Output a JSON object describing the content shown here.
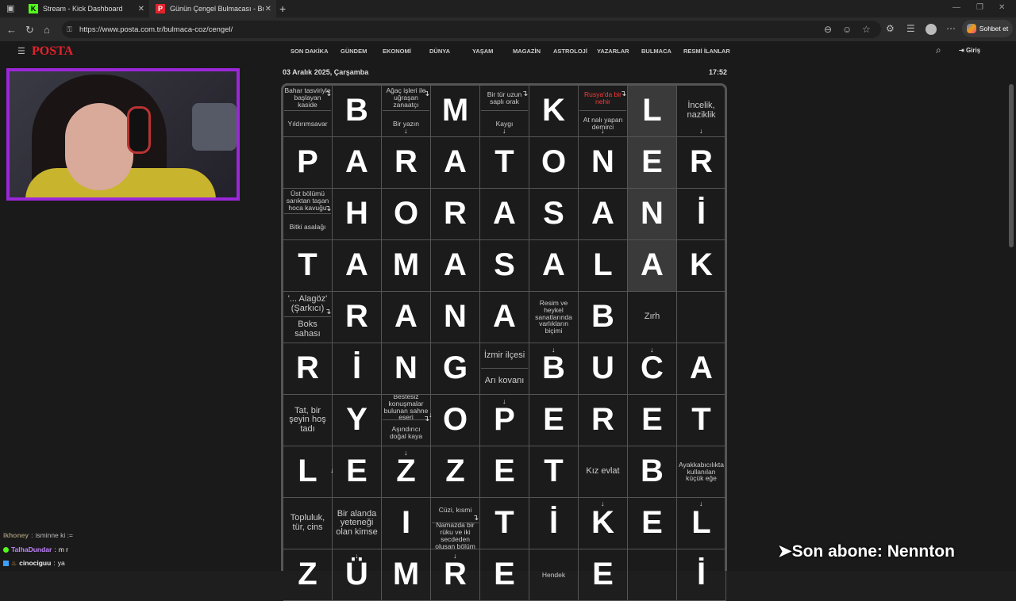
{
  "tabs": [
    {
      "title": "Stream - Kick Dashboard",
      "favicon": "K"
    },
    {
      "title": "Günün Çengel Bulmacası - Bugün",
      "favicon": "P"
    }
  ],
  "address": "https://www.posta.com.tr/bulmaca-coz/cengel/",
  "chat_button": "Sohbet et",
  "site": {
    "logo": "POSTA",
    "menu": [
      "SON DAKİKA",
      "GÜNDEM",
      "EKONOMİ",
      "DÜNYA",
      "YAŞAM",
      "MAGAZİN",
      "ASTROLOJİ",
      "YAZARLAR",
      "BULMACA",
      "RESMİ İLANLAR"
    ],
    "login": "Giriş",
    "date": "03 Aralık 2025, Çarşamba",
    "time": "17:52"
  },
  "grid": [
    [
      {
        "t": "split",
        "top": "Bahar tasviriyle başlayan kaside",
        "bot": "Yıldırımsavar"
      },
      {
        "t": "L",
        "v": "B"
      },
      {
        "t": "split",
        "top": "Ağaç işleri ile uğraşan zanaatçı",
        "bot": "Bir yazın"
      },
      {
        "t": "L",
        "v": "M"
      },
      {
        "t": "split",
        "top": "Bir tür uzun saplı orak",
        "bot": "Kaygı"
      },
      {
        "t": "L",
        "v": "K"
      },
      {
        "t": "split",
        "top": "Rusya'da bir nehir",
        "bot": "At nalı yapan demirci",
        "red": true
      },
      {
        "t": "L",
        "v": "L",
        "hl": true
      },
      {
        "t": "clue",
        "v": "İncelik, naziklik",
        "big": true
      }
    ],
    [
      {
        "t": "L",
        "v": "P"
      },
      {
        "t": "L",
        "v": "A"
      },
      {
        "t": "L",
        "v": "R"
      },
      {
        "t": "L",
        "v": "A"
      },
      {
        "t": "L",
        "v": "T"
      },
      {
        "t": "L",
        "v": "O"
      },
      {
        "t": "L",
        "v": "N"
      },
      {
        "t": "L",
        "v": "E",
        "hl": true
      },
      {
        "t": "L",
        "v": "R"
      }
    ],
    [
      {
        "t": "split",
        "top": "Üst bölümü sarıktan taşan hoca kavuğu",
        "bot": "Bitki asalağı"
      },
      {
        "t": "L",
        "v": "H"
      },
      {
        "t": "L",
        "v": "O"
      },
      {
        "t": "L",
        "v": "R"
      },
      {
        "t": "L",
        "v": "A"
      },
      {
        "t": "L",
        "v": "S"
      },
      {
        "t": "L",
        "v": "A"
      },
      {
        "t": "L",
        "v": "N",
        "hl": true
      },
      {
        "t": "L",
        "v": "İ"
      }
    ],
    [
      {
        "t": "L",
        "v": "T"
      },
      {
        "t": "L",
        "v": "A"
      },
      {
        "t": "L",
        "v": "M"
      },
      {
        "t": "L",
        "v": "A"
      },
      {
        "t": "L",
        "v": "S"
      },
      {
        "t": "L",
        "v": "A"
      },
      {
        "t": "L",
        "v": "L"
      },
      {
        "t": "L",
        "v": "A",
        "hl": true
      },
      {
        "t": "L",
        "v": "K"
      }
    ],
    [
      {
        "t": "split",
        "top": "'... Alagöz' (Şarkıcı)",
        "bot": "Boks sahası",
        "big": true
      },
      {
        "t": "L",
        "v": "R"
      },
      {
        "t": "L",
        "v": "A"
      },
      {
        "t": "L",
        "v": "N"
      },
      {
        "t": "L",
        "v": "A"
      },
      {
        "t": "clue",
        "v": "Resim ve heykel sanatlarında varlıkların biçimi"
      },
      {
        "t": "L",
        "v": "B"
      },
      {
        "t": "clue",
        "v": "Zırh",
        "big": true
      },
      {
        "t": "empty"
      }
    ],
    [
      {
        "t": "L",
        "v": "R"
      },
      {
        "t": "L",
        "v": "İ"
      },
      {
        "t": "L",
        "v": "N"
      },
      {
        "t": "L",
        "v": "G"
      },
      {
        "t": "split",
        "top": "İzmir ilçesi",
        "bot": "Arı kovanı",
        "big": true
      },
      {
        "t": "L",
        "v": "B"
      },
      {
        "t": "L",
        "v": "U"
      },
      {
        "t": "L",
        "v": "C"
      },
      {
        "t": "L",
        "v": "A"
      }
    ],
    [
      {
        "t": "clue",
        "v": "Tat, bir şeyin hoş tadı",
        "big": true
      },
      {
        "t": "L",
        "v": "Y"
      },
      {
        "t": "split",
        "top": "Bestesiz konuşmalar bulunan sahne eseri",
        "bot": "Aşındırıcı doğal kaya"
      },
      {
        "t": "L",
        "v": "O"
      },
      {
        "t": "L",
        "v": "P"
      },
      {
        "t": "L",
        "v": "E"
      },
      {
        "t": "L",
        "v": "R"
      },
      {
        "t": "L",
        "v": "E"
      },
      {
        "t": "L",
        "v": "T"
      }
    ],
    [
      {
        "t": "L",
        "v": "L"
      },
      {
        "t": "L",
        "v": "E"
      },
      {
        "t": "L",
        "v": "Z"
      },
      {
        "t": "L",
        "v": "Z"
      },
      {
        "t": "L",
        "v": "E"
      },
      {
        "t": "L",
        "v": "T"
      },
      {
        "t": "clue",
        "v": "Kız evlat",
        "big": true
      },
      {
        "t": "L",
        "v": "B"
      },
      {
        "t": "clue",
        "v": "Ayakkabıcılıkta kullanılan küçük eğe"
      }
    ],
    [
      {
        "t": "clue",
        "v": "Topluluk, tür, cins",
        "big": true
      },
      {
        "t": "clue",
        "v": "Bir alanda yeteneği olan kimse",
        "big": true
      },
      {
        "t": "L",
        "v": "I"
      },
      {
        "t": "split",
        "top": "Cüzi, kısmi",
        "bot": "Namazda bir rüku ve iki secdeden oluşan bölüm"
      },
      {
        "t": "L",
        "v": "T"
      },
      {
        "t": "L",
        "v": "İ"
      },
      {
        "t": "L",
        "v": "K"
      },
      {
        "t": "L",
        "v": "E"
      },
      {
        "t": "L",
        "v": "L"
      }
    ],
    [
      {
        "t": "L",
        "v": "Z"
      },
      {
        "t": "L",
        "v": "Ü"
      },
      {
        "t": "L",
        "v": "M"
      },
      {
        "t": "L",
        "v": "R"
      },
      {
        "t": "L",
        "v": "E"
      },
      {
        "t": "clue",
        "v": "Hendek"
      },
      {
        "t": "L",
        "v": "E"
      },
      {
        "t": "empty"
      },
      {
        "t": "L",
        "v": "İ"
      }
    ]
  ],
  "chat": [
    {
      "user": "ikhoney",
      "msg": "isminne ki :="
    },
    {
      "user": "TalhaDundar",
      "msg": "m r"
    },
    {
      "user": "cinociguu",
      "msg": "ya"
    }
  ],
  "overlay": {
    "sub": "➤Son abone: Nennton"
  }
}
